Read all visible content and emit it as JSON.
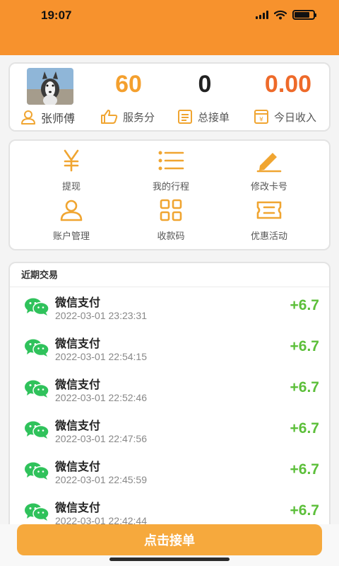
{
  "status_bar": {
    "time": "19:07"
  },
  "profile": {
    "name": "张师傅",
    "stats": [
      {
        "value": "60",
        "label": "服务分",
        "color": "#f4a02e"
      },
      {
        "value": "0",
        "label": "总接单",
        "color": "#222222"
      },
      {
        "value": "0.00",
        "label": "今日收入",
        "color": "#ee6a2a"
      }
    ]
  },
  "menu": [
    {
      "label": "提现",
      "icon": "yen-icon"
    },
    {
      "label": "我的行程",
      "icon": "list-icon"
    },
    {
      "label": "修改卡号",
      "icon": "pencil-icon"
    },
    {
      "label": "账户管理",
      "icon": "user-icon"
    },
    {
      "label": "收款码",
      "icon": "grid-icon"
    },
    {
      "label": "优惠活动",
      "icon": "ticket-icon"
    }
  ],
  "transactions": {
    "title": "近期交易",
    "items": [
      {
        "name": "微信支付",
        "time": "2022-03-01 23:23:31",
        "amount": "+6.7"
      },
      {
        "name": "微信支付",
        "time": "2022-03-01 22:54:15",
        "amount": "+6.7"
      },
      {
        "name": "微信支付",
        "time": "2022-03-01 22:52:46",
        "amount": "+6.7"
      },
      {
        "name": "微信支付",
        "time": "2022-03-01 22:47:56",
        "amount": "+6.7"
      },
      {
        "name": "微信支付",
        "time": "2022-03-01 22:45:59",
        "amount": "+6.7"
      },
      {
        "name": "微信支付",
        "time": "2022-03-01 22:42:44",
        "amount": "+6.7"
      }
    ]
  },
  "action_button": {
    "label": "点击接单"
  },
  "colors": {
    "header": "#f7922d",
    "accent": "#f0a531",
    "income": "#5cbf3a",
    "wechat": "#2fc25b"
  }
}
